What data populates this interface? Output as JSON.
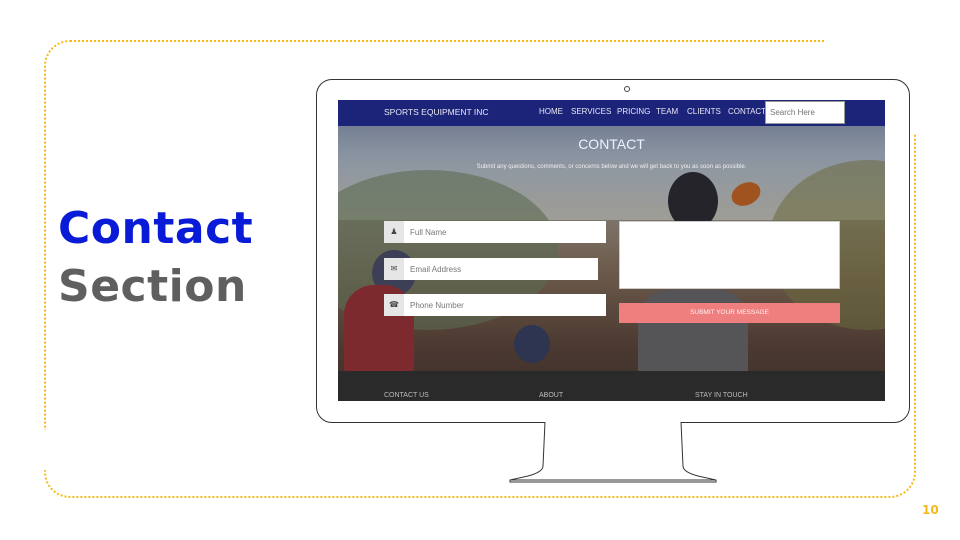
{
  "slide": {
    "title_line1": "Contact",
    "title_line2": "Section",
    "page_number": "10",
    "colors": {
      "accent_dots": "#f6b916",
      "title_blue": "#0a1bd8",
      "title_gray": "#5f5f5f"
    }
  },
  "site": {
    "brand": "SPORTS EQUIPMENT INC",
    "nav": [
      "HOME",
      "SERVICES",
      "PRICING",
      "TEAM",
      "CLIENTS",
      "CONTACT"
    ],
    "search_placeholder": "Search Here",
    "contact_heading": "CONTACT",
    "contact_subtext": "Submit any questions, comments, or concerns below and we will get back to you as soon as possible.",
    "fields": {
      "full_name": "Full Name",
      "email": "Email Address",
      "phone": "Phone Number"
    },
    "submit_label": "SUBMIT YOUR MESSAGE",
    "footer": [
      "CONTACT US",
      "ABOUT",
      "STAY IN TOUCH"
    ],
    "icons": {
      "name": "user-icon",
      "email": "envelope-icon",
      "phone": "phone-icon"
    }
  }
}
